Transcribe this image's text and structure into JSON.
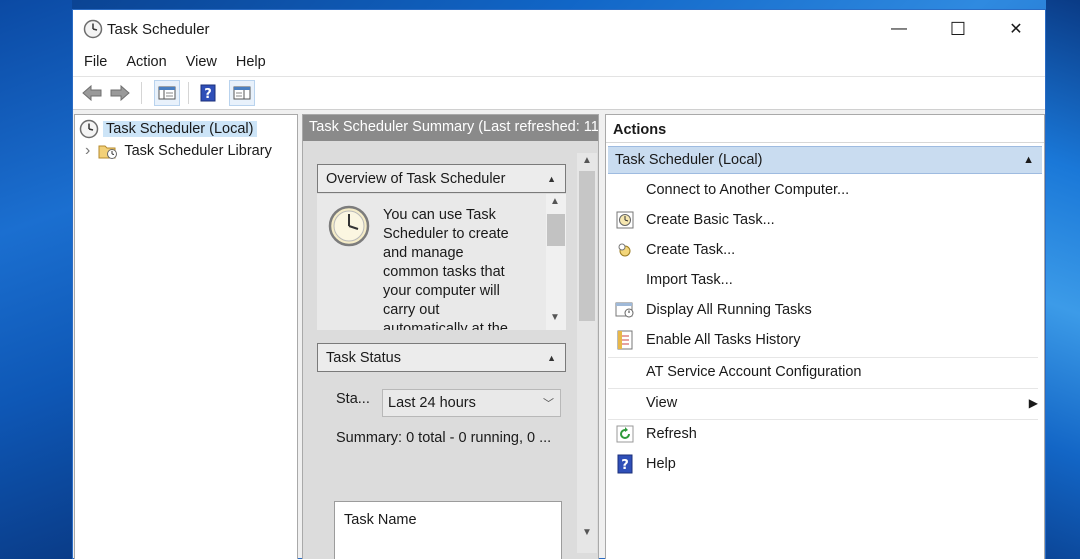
{
  "window": {
    "title": "Task Scheduler",
    "controls": {
      "minimize": "—",
      "maximize": "☐",
      "close": "✕"
    }
  },
  "menubar": [
    "File",
    "Action",
    "View",
    "Help"
  ],
  "toolbar": {
    "icons": [
      "back-arrow-icon",
      "forward-arrow-icon",
      "show-hide-console-tree-icon",
      "help-icon",
      "show-hide-action-pane-icon"
    ]
  },
  "tree": {
    "root": "Task Scheduler (Local)",
    "child": "Task Scheduler Library",
    "expander": "›"
  },
  "summary": {
    "header": "Task Scheduler Summary (Last refreshed: 11/",
    "overview": {
      "title": "Overview of Task Scheduler",
      "text_lines": [
        "You can use Task",
        "Scheduler to create",
        "and manage",
        "common tasks that",
        "your computer will",
        "carry out",
        "automatically at the"
      ]
    },
    "status": {
      "title": "Task Status",
      "filter_label": "Sta...",
      "filter_value": "Last 24 hours",
      "summary_text": "Summary: 0 total - 0 running, 0 ...",
      "table_header": "Task Name"
    }
  },
  "actions": {
    "title": "Actions",
    "group": "Task Scheduler (Local)",
    "items": [
      {
        "label": "Connect to Another Computer...",
        "icon": ""
      },
      {
        "label": "Create Basic Task...",
        "icon": "create-basic-task-icon"
      },
      {
        "label": "Create Task...",
        "icon": "create-task-icon"
      },
      {
        "label": "Import Task...",
        "icon": ""
      },
      {
        "label": "Display All Running Tasks",
        "icon": "display-running-tasks-icon"
      },
      {
        "label": "Enable All Tasks History",
        "icon": "tasks-history-icon"
      },
      {
        "label": "AT Service Account Configuration",
        "icon": ""
      },
      {
        "label": "View",
        "icon": ""
      },
      {
        "label": "Refresh",
        "icon": "refresh-icon"
      },
      {
        "label": "Help",
        "icon": "help-icon"
      }
    ]
  },
  "colors": {
    "selection": "#cce4f7",
    "actions_group": "#c9dcf0",
    "mid_header": "#8a8a8a",
    "desktop_blue": "#1166c7"
  }
}
